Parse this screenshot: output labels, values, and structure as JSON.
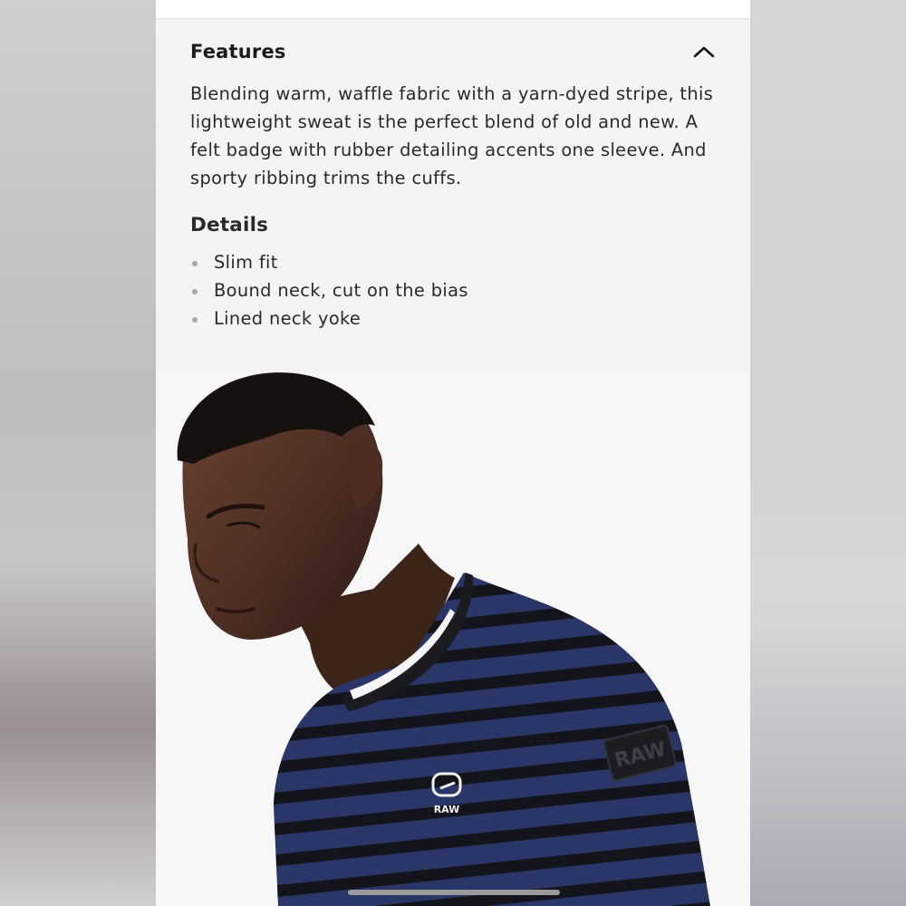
{
  "features": {
    "title": "Features",
    "toggle_icon": "chevron-up-icon",
    "description": "Blending warm, waffle fabric with a yarn-dyed stripe, this lightweight sweat is the perfect blend of old and new. A felt badge with rubber detailing accents one sleeve. And sporty ribbing trims the cuffs."
  },
  "details": {
    "title": "Details",
    "items": [
      {
        "label": "Slim fit"
      },
      {
        "label": "Bound neck, cut on the bias"
      },
      {
        "label": "Lined neck yoke"
      }
    ]
  },
  "product_image": {
    "logo_text": "RAW",
    "sleeve_badge_text": "RAW"
  },
  "colors": {
    "background": "#f4f4f4",
    "text": "#2a2a2a",
    "sweater_navy": "#2a3566",
    "stripe_black": "#15161d"
  }
}
